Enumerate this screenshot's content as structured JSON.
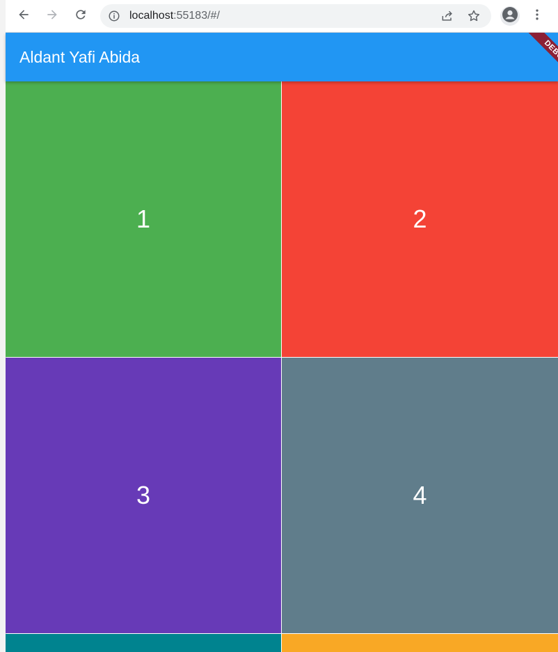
{
  "browser": {
    "url_host": "localhost",
    "url_rest": ":55183/#/",
    "icons": {
      "back": "arrow-left-icon",
      "forward": "arrow-right-icon",
      "reload": "reload-icon",
      "info": "info-icon",
      "share": "share-icon",
      "bookmark": "star-icon",
      "profile": "account-icon",
      "menu": "more-vert-icon"
    }
  },
  "app": {
    "title": "Aldant Yafi Abida",
    "debug_banner": "DEBUG",
    "colors": {
      "appbar": "#2196f3",
      "tile1": "#4caf50",
      "tile2": "#f44336",
      "tile3": "#673ab7",
      "tile4": "#607d8b",
      "tile5": "#00838f",
      "tile6": "#f9a825"
    },
    "tiles": [
      {
        "label": "1"
      },
      {
        "label": "2"
      },
      {
        "label": "3"
      },
      {
        "label": "4"
      },
      {
        "label": ""
      },
      {
        "label": ""
      }
    ]
  }
}
